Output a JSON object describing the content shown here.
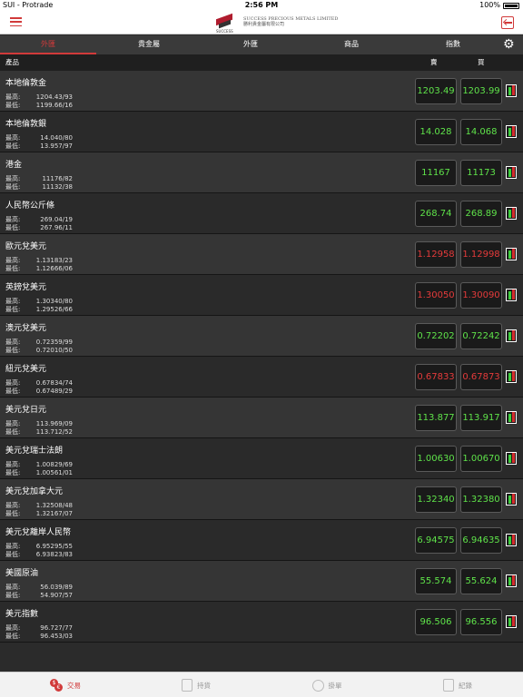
{
  "statusbar": {
    "carrier": "SUI - Protrade",
    "time": "2:56 PM",
    "battery": "100%"
  },
  "header": {
    "logo_brand": "SUCCESS",
    "logo_line1": "SUCCESS PRECIOUS METALS LIMITED",
    "logo_line2": "勝利貴金屬有限公司"
  },
  "tabs": [
    {
      "label": "外匯",
      "active": true
    },
    {
      "label": "貴金屬",
      "active": false
    },
    {
      "label": "外匯",
      "active": false
    },
    {
      "label": "商品",
      "active": false
    },
    {
      "label": "指數",
      "active": false
    }
  ],
  "columns": {
    "product": "產品",
    "sell": "賣",
    "buy": "買"
  },
  "labels": {
    "high": "最高:",
    "low": "最低:"
  },
  "products": [
    {
      "name": "本地倫敦金",
      "high": "1204.43/93",
      "low": "1199.66/16",
      "sell": "1203.49",
      "buy": "1203.99",
      "dir": "up"
    },
    {
      "name": "本地倫敦銀",
      "high": "14.040/80",
      "low": "13.957/97",
      "sell": "14.028",
      "buy": "14.068",
      "dir": "up"
    },
    {
      "name": "港金",
      "high": "11176/82",
      "low": "11132/38",
      "sell": "11167",
      "buy": "11173",
      "dir": "up"
    },
    {
      "name": "人民幣公斤條",
      "high": "269.04/19",
      "low": "267.96/11",
      "sell": "268.74",
      "buy": "268.89",
      "dir": "up"
    },
    {
      "name": "歐元兌美元",
      "high": "1.13183/23",
      "low": "1.12666/06",
      "sell": "1.12958",
      "buy": "1.12998",
      "dir": "down"
    },
    {
      "name": "英鎊兌美元",
      "high": "1.30340/80",
      "low": "1.29526/66",
      "sell": "1.30050",
      "buy": "1.30090",
      "dir": "down"
    },
    {
      "name": "澳元兌美元",
      "high": "0.72359/99",
      "low": "0.72010/50",
      "sell": "0.72202",
      "buy": "0.72242",
      "dir": "up"
    },
    {
      "name": "紐元兌美元",
      "high": "0.67834/74",
      "low": "0.67489/29",
      "sell": "0.67833",
      "buy": "0.67873",
      "dir": "down"
    },
    {
      "name": "美元兌日元",
      "high": "113.969/09",
      "low": "113.712/52",
      "sell": "113.877",
      "buy": "113.917",
      "dir": "up"
    },
    {
      "name": "美元兌瑞士法朗",
      "high": "1.00829/69",
      "low": "1.00561/01",
      "sell": "1.00630",
      "buy": "1.00670",
      "dir": "up"
    },
    {
      "name": "美元兌加拿大元",
      "high": "1.32508/48",
      "low": "1.32167/07",
      "sell": "1.32340",
      "buy": "1.32380",
      "dir": "up"
    },
    {
      "name": "美元兌離岸人民幣",
      "high": "6.95295/55",
      "low": "6.93823/83",
      "sell": "6.94575",
      "buy": "6.94635",
      "dir": "up"
    },
    {
      "name": "美國原油",
      "high": "56.039/89",
      "low": "54.907/57",
      "sell": "55.574",
      "buy": "55.624",
      "dir": "up"
    },
    {
      "name": "美元指數",
      "high": "96.727/77",
      "low": "96.453/03",
      "sell": "96.506",
      "buy": "96.556",
      "dir": "up"
    }
  ],
  "bottom_nav": [
    {
      "label": "交易",
      "icon": "trade-coins-icon",
      "active": true
    },
    {
      "label": "持貨",
      "icon": "holdings-document-icon",
      "active": false
    },
    {
      "label": "掛單",
      "icon": "pending-order-clock-icon",
      "active": false
    },
    {
      "label": "紀錄",
      "icon": "records-document-icon",
      "active": false
    }
  ],
  "colors": {
    "accent": "#d13a3a",
    "up": "#5fe34a",
    "down": "#e53b3b"
  }
}
